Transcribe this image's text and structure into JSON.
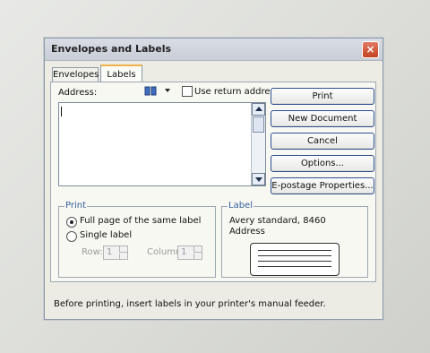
{
  "title": "Envelopes and Labels",
  "close_label": "×",
  "tabs": [
    {
      "label": "Envelopes"
    },
    {
      "label": "Labels"
    }
  ],
  "address": {
    "label": "Address:",
    "value": "",
    "use_return_address_label": "Use return address"
  },
  "buttons": {
    "print": "Print",
    "new_document": "New Document",
    "cancel": "Cancel",
    "options": "Options...",
    "epostage": "E-postage Properties..."
  },
  "print_group": {
    "title": "Print",
    "full_page_label": "Full page of the same label",
    "single_label_label": "Single label",
    "row_label": "Row:",
    "row_value": "1",
    "column_label": "Column:",
    "column_value": "1"
  },
  "label_group": {
    "title": "Label",
    "line1": "Avery standard, 8460",
    "line2": "Address"
  },
  "status_text": "Before printing, insert labels in your printer's manual feeder."
}
